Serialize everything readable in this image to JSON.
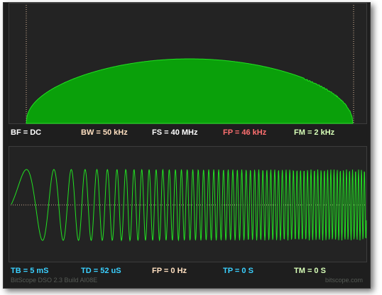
{
  "spectrum_labels": {
    "bf": {
      "text": "BF = DC",
      "color": "#ffffff"
    },
    "bw": {
      "text": "BW = 50 kHz",
      "color": "#ffe0c0"
    },
    "fs": {
      "text": "FS = 40 MHz",
      "color": "#ffffff"
    },
    "fp": {
      "text": "FP = 46 kHz",
      "color": "#ff7070"
    },
    "fm": {
      "text": "FM = 2 kHz",
      "color": "#d8ffb8"
    }
  },
  "waveform_labels": {
    "tb": {
      "text": "TB = 5 mS",
      "color": "#3ad0ff"
    },
    "td": {
      "text": "TD = 52 uS",
      "color": "#3ad0ff"
    },
    "fp": {
      "text": "FP = 0 Hz",
      "color": "#ffe0c0"
    },
    "tp": {
      "text": "TP = 0 S",
      "color": "#3ad0ff"
    },
    "tm": {
      "text": "TM = 0 S",
      "color": "#d8ffb8"
    }
  },
  "footer": {
    "product": "BitScope DSO 2.3 Build AI08E",
    "site": "bitscope.com"
  },
  "colors": {
    "trace": "#22e022",
    "spectrum_fill": "#0aa00a",
    "cursor_line": "#d9b79a",
    "background": "#232323"
  }
}
